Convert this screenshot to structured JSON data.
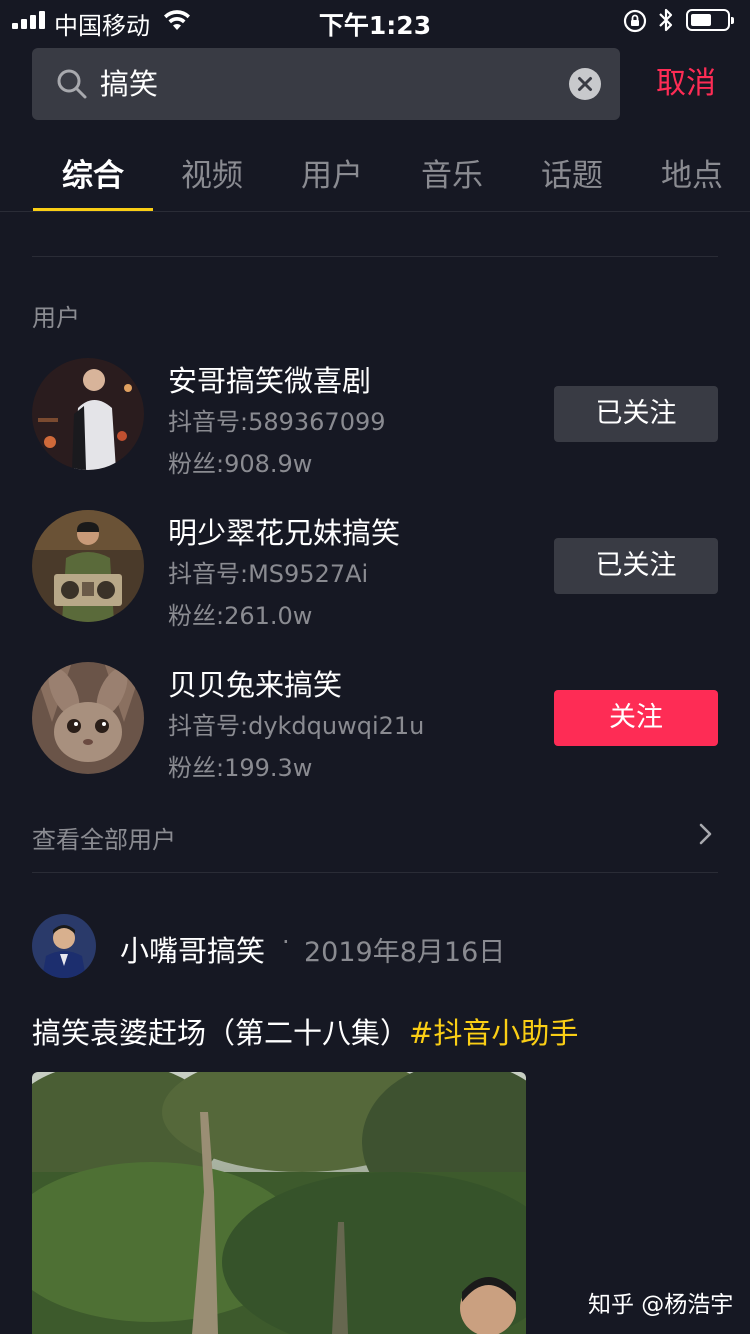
{
  "status_bar": {
    "carrier": "中国移动",
    "time": "下午1:23"
  },
  "search": {
    "query": "搞笑",
    "cancel_label": "取消"
  },
  "tabs": [
    {
      "label": "综合",
      "active": true
    },
    {
      "label": "视频",
      "active": false
    },
    {
      "label": "用户",
      "active": false
    },
    {
      "label": "音乐",
      "active": false
    },
    {
      "label": "话题",
      "active": false
    },
    {
      "label": "地点",
      "active": false
    }
  ],
  "users_section": {
    "title": "用户",
    "users": [
      {
        "name": "安哥搞笑微喜剧",
        "douyin_id": "抖音号:589367099",
        "fans": "粉丝:908.9w",
        "follow_label": "已关注",
        "followed": true
      },
      {
        "name": "明少翠花兄妹搞笑",
        "douyin_id": "抖音号:MS9527Ai",
        "fans": "粉丝:261.0w",
        "follow_label": "已关注",
        "followed": true
      },
      {
        "name": "贝贝兔来搞笑",
        "douyin_id": "抖音号:dykdquwqi21u",
        "fans": "粉丝:199.3w",
        "follow_label": "关注",
        "followed": false
      }
    ],
    "see_all_label": "查看全部用户"
  },
  "post": {
    "author": "小嘴哥搞笑",
    "separator": "·",
    "date": "2019年8月16日",
    "caption": "搞笑袁婆赶场（第二十八集）",
    "hashtag": "#抖音小助手"
  },
  "watermark": "知乎 @杨浩宇",
  "colors": {
    "background": "#161823",
    "accent_red": "#fe2c55",
    "accent_yellow": "#face15",
    "button_gray": "#393b44"
  }
}
